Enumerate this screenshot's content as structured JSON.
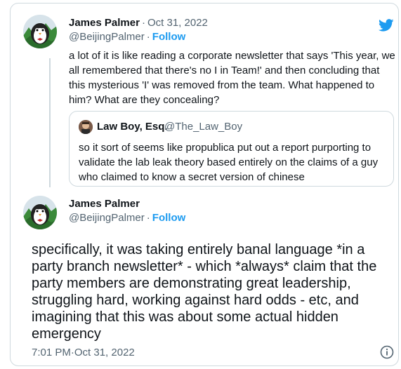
{
  "tweet1": {
    "author_name": "James Palmer",
    "date": "Oct 31, 2022",
    "handle": "@BeijingPalmer",
    "follow_label": "Follow",
    "text": "a lot of it is like reading a corporate newsletter that says 'This year, we all remembered that there's no I in Team!' and then concluding that this mysterious 'I' was removed from the team. What happened to him? What are they concealing?"
  },
  "quoted": {
    "author_name": "Law Boy, Esq.",
    "handle": "@The_Law_Boy",
    "text": "so it sort of seems like propublica put out a report purporting to validate the lab leak theory based entirely on the claims of a guy who claimed to know a secret version of chinese"
  },
  "tweet2": {
    "author_name": "James Palmer",
    "handle": "@BeijingPalmer",
    "follow_label": "Follow",
    "text": "specifically, it was taking entirely banal language *in a party branch newsletter* - which *always* claim that the party members are demonstrating great leadership, struggling hard, working against hard odds - etc, and imagining that this was about some actual hidden emergency",
    "time": "7:01 PM",
    "date": "Oct 31, 2022"
  },
  "separator": "·",
  "colors": {
    "accent": "#1d9bf0",
    "text_primary": "#0f1419",
    "text_secondary": "#536471",
    "border": "#cfd9de"
  },
  "icons": {
    "logo": "twitter-bird-icon",
    "info": "info-circle-icon"
  }
}
